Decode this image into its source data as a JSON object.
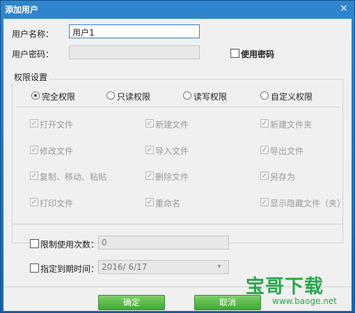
{
  "window": {
    "title": "添加用户",
    "close": "×"
  },
  "fields": {
    "username_label": "用户名称：",
    "username_value": "用户1",
    "password_label": "用户密码：",
    "password_value": "",
    "use_password_label": "使用密码"
  },
  "permissions": {
    "group_title": "权限设置",
    "radios": [
      {
        "label": "完全权限",
        "checked": true
      },
      {
        "label": "只读权限",
        "checked": false
      },
      {
        "label": "读写权限",
        "checked": false
      },
      {
        "label": "自定义权限",
        "checked": false
      }
    ],
    "items": [
      "打开文件",
      "新建文件",
      "新建文件夹",
      "修改文件",
      "导入文件",
      "导出文件",
      "复制、移动、粘贴",
      "删除文件",
      "另存为",
      "打印文件",
      "重命名",
      "显示隐藏文件（夹）"
    ]
  },
  "limits": {
    "use_count_label": "限制使用次数：",
    "use_count_value": "0",
    "expire_label": "指定到期时间：",
    "expire_value": "2016/  6/17"
  },
  "buttons": {
    "ok": "确定",
    "cancel": "取消"
  },
  "watermark": {
    "text": "宝哥下载",
    "url": "www.baoge.net",
    "color": "#27a84a"
  }
}
